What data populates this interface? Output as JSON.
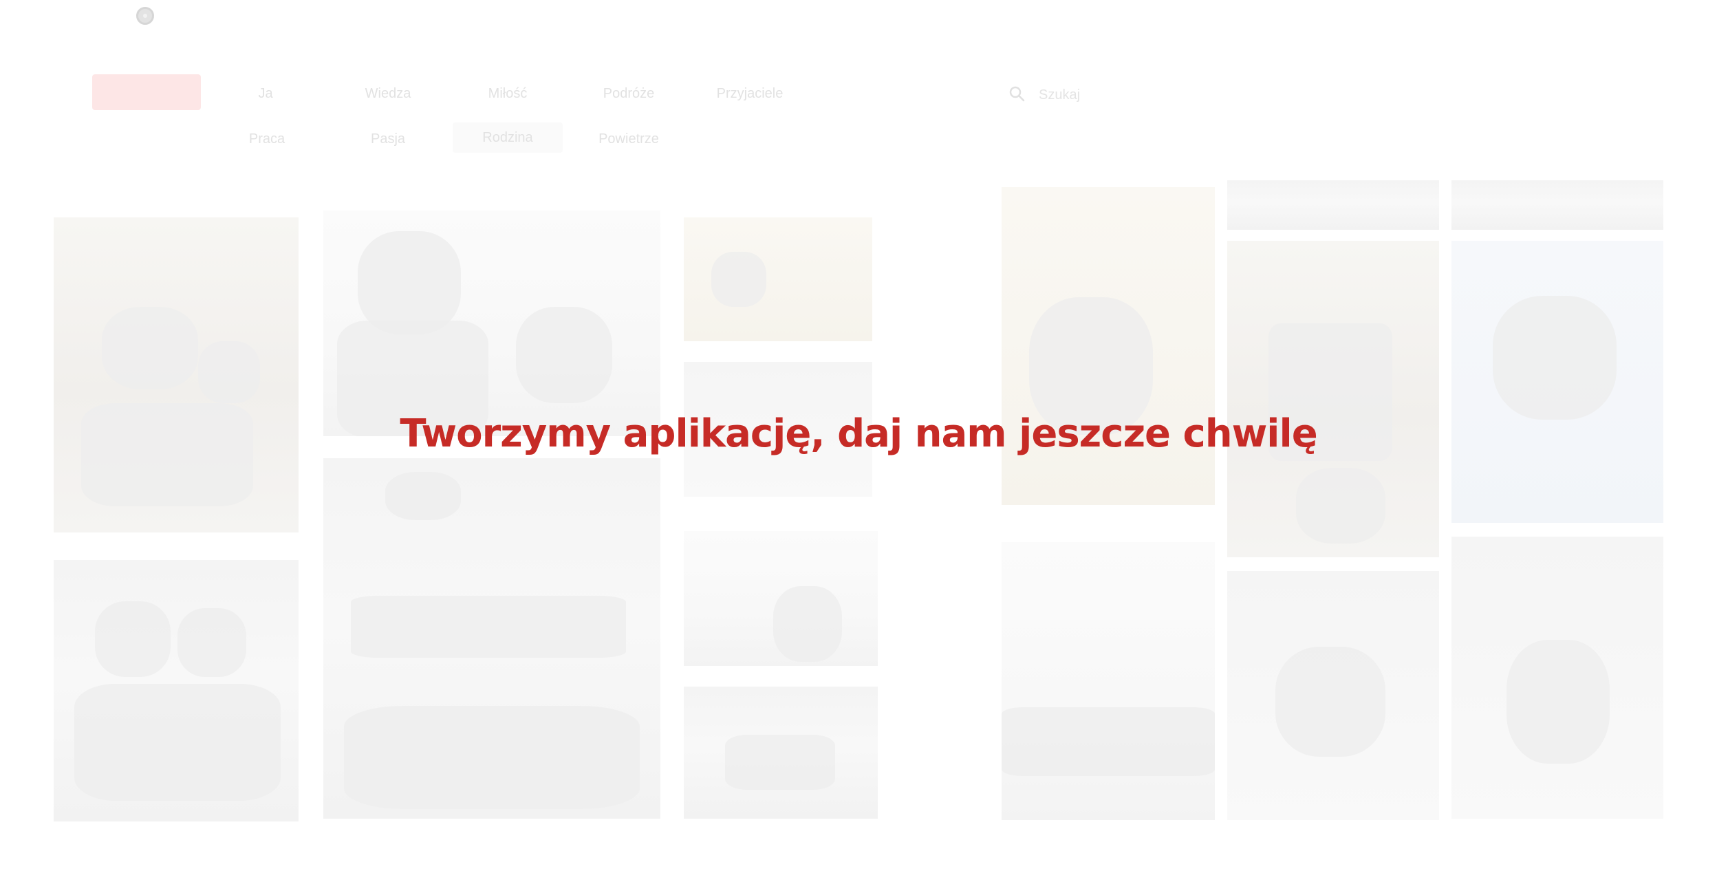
{
  "nav": {
    "row1": [
      "Ja",
      "Wiedza",
      "Miłość",
      "Podróże",
      "Przyjaciele"
    ],
    "row2": [
      "Praca",
      "Pasja",
      "Rodzina",
      "Powietrze"
    ],
    "selected": "Rodzina"
  },
  "search": {
    "placeholder": "Szukaj",
    "icon": "search-icon"
  },
  "top_icon": "settings-icon",
  "overlay": {
    "message": "Tworzymy aplikację, daj nam jeszcze chwilę",
    "color": "#c62b26"
  },
  "colors": {
    "accent": "#c62b26",
    "home_button": "#fde6e6",
    "background": "#ffffff"
  }
}
